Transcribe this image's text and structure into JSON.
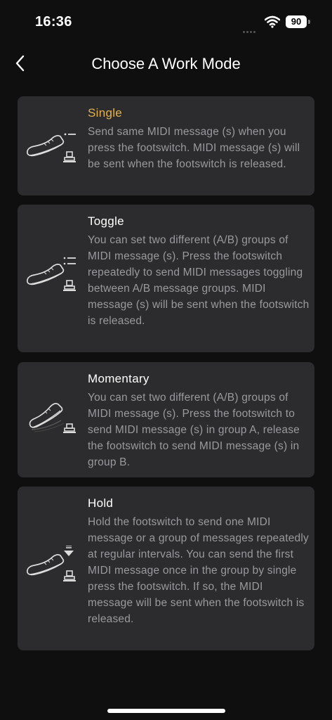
{
  "status": {
    "time": "16:36",
    "battery": "90"
  },
  "header": {
    "title": "Choose A Work Mode"
  },
  "modes": [
    {
      "title": "Single",
      "selected": true,
      "description": "Send same MIDI message (s) when you press the footswitch. MIDI message (s) will be sent when the footswitch is released."
    },
    {
      "title": "Toggle",
      "selected": false,
      "description": "You can set two different (A/B) groups of MIDI message (s). Press the footswitch repeatedly to send MIDI messages toggling between A/B message groups. MIDI message (s) will be sent when the footswitch is released."
    },
    {
      "title": "Momentary",
      "selected": false,
      "description": "You can set two different (A/B) groups of MIDI message (s). Press the footswitch to send MIDI message (s) in group A, release the footswitch to send MIDI message (s) in group B."
    },
    {
      "title": "Hold",
      "selected": false,
      "description": "Hold the footswitch to send one MIDI message or a group of messages repeatedly at regular intervals. You can send the first MIDI message once in the group by single press the footswitch. If so, the MIDI message will be sent when the footswitch is released."
    }
  ],
  "colors": {
    "accent": "#e3b24f",
    "card_bg": "#2c2c2e",
    "page_bg": "#0f0f10",
    "desc_text": "#9a9a9e"
  }
}
